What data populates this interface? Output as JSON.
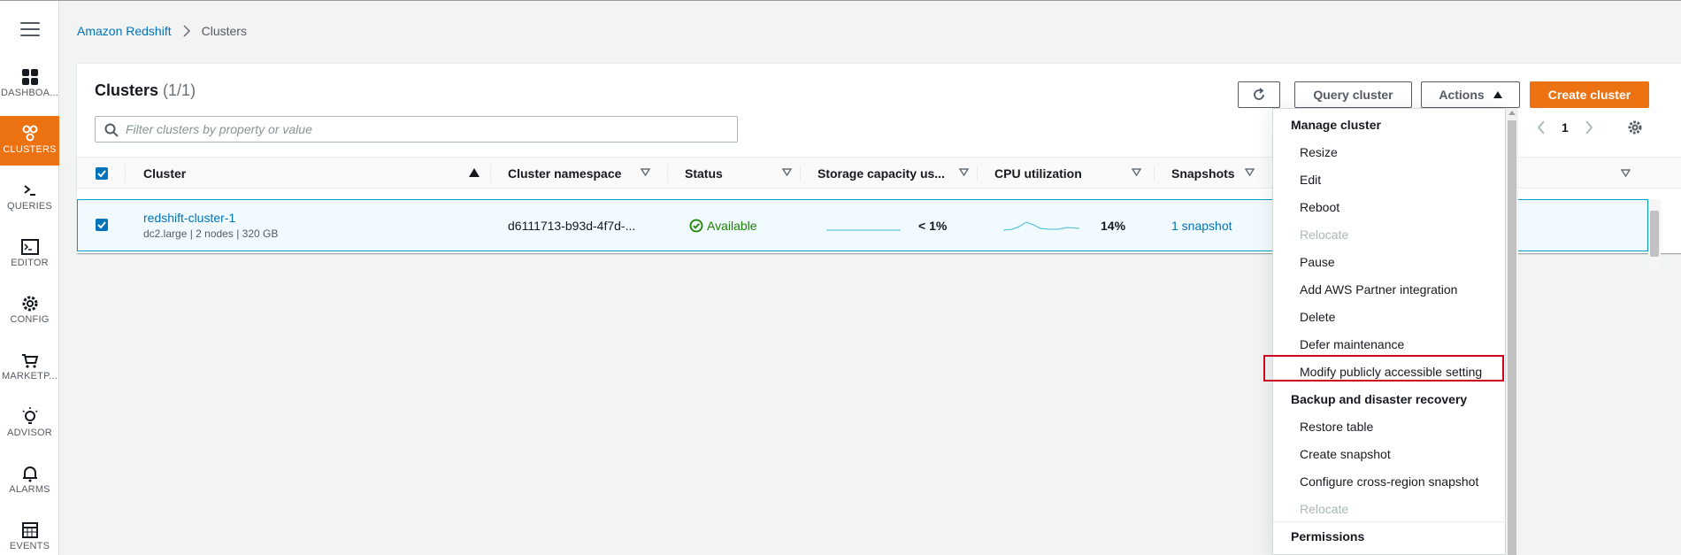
{
  "nav": {
    "items": [
      {
        "label": "DASHBOA...",
        "icon": "dashboard-icon"
      },
      {
        "label": "CLUSTERS",
        "icon": "clusters-icon",
        "active": true
      },
      {
        "label": "QUERIES",
        "icon": "queries-icon"
      },
      {
        "label": "EDITOR",
        "icon": "editor-icon"
      },
      {
        "label": "CONFIG",
        "icon": "config-gear-icon"
      },
      {
        "label": "MARKETP...",
        "icon": "marketplace-cart-icon"
      },
      {
        "label": "ADVISOR",
        "icon": "advisor-bulb-icon"
      },
      {
        "label": "ALARMS",
        "icon": "alarms-bell-icon"
      },
      {
        "label": "EVENTS",
        "icon": "events-calendar-icon"
      }
    ]
  },
  "breadcrumb": {
    "root": "Amazon Redshift",
    "current": "Clusters"
  },
  "panel": {
    "title": "Clusters",
    "count": "(1/1)",
    "query_button": "Query cluster",
    "actions_button": "Actions",
    "create_button": "Create cluster",
    "filter_placeholder": "Filter clusters by property or value",
    "page_number": "1"
  },
  "table": {
    "columns": [
      "Cluster",
      "Cluster namespace",
      "Status",
      "Storage capacity us...",
      "CPU utilization",
      "Snapshots"
    ],
    "rows": [
      {
        "name": "redshift-cluster-1",
        "details": "dc2.large | 2 nodes | 320 GB",
        "namespace": "d6111713-b93d-4f7d-...",
        "status": "Available",
        "storage": "< 1%",
        "cpu": "14%",
        "snapshots": "1 snapshot"
      }
    ]
  },
  "actions_menu": {
    "group_manage": "Manage cluster",
    "manage_items": [
      "Resize",
      "Edit",
      "Reboot",
      "Relocate",
      "Pause",
      "Add AWS Partner integration",
      "Delete",
      "Defer maintenance",
      "Modify publicly accessible setting"
    ],
    "group_backup": "Backup and disaster recovery",
    "backup_items": [
      "Restore table",
      "Create snapshot",
      "Configure cross-region snapshot",
      "Relocate"
    ],
    "group_permissions": "Permissions"
  },
  "colors": {
    "accent_orange": "#ec7211",
    "link_blue": "#0073bb",
    "status_green": "#1d8102",
    "highlight_red": "#d0021b"
  }
}
